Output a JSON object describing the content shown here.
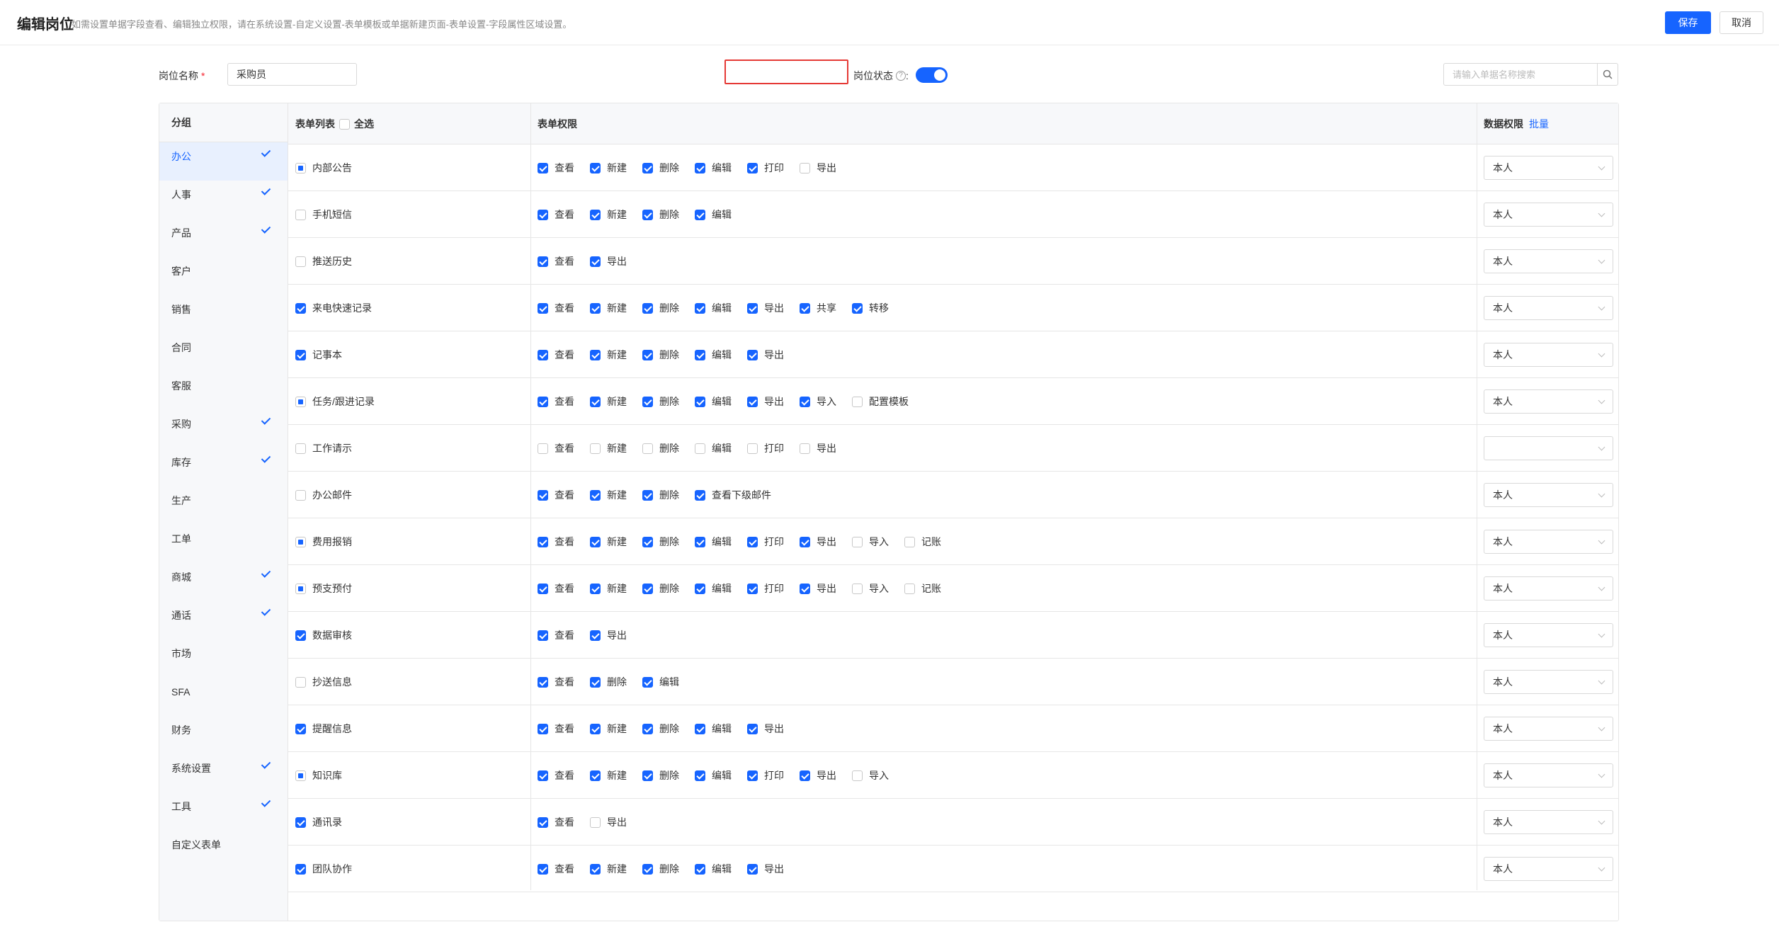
{
  "header": {
    "title": "编辑岗位",
    "hint": "如需设置单据字段查看、编辑独立权限，请在系统设置-自定义设置-表单模板或单据新建页面-表单设置-字段属性区域设置。",
    "save_label": "保存",
    "cancel_label": "取消"
  },
  "form": {
    "name_label": "岗位名称",
    "required_mark": "*",
    "name_value": "采购员",
    "status_label": "岗位状态",
    "help_glyph": "?",
    "status_colon": ":",
    "status_on": true,
    "search_placeholder": "请输入单据名称搜索"
  },
  "sidebar": {
    "header": "分组",
    "items": [
      {
        "label": "办公",
        "checked": true,
        "active": true
      },
      {
        "label": "人事",
        "checked": true
      },
      {
        "label": "产品",
        "checked": true
      },
      {
        "label": "客户",
        "checked": false
      },
      {
        "label": "销售",
        "checked": false
      },
      {
        "label": "合同",
        "checked": false
      },
      {
        "label": "客服",
        "checked": false
      },
      {
        "label": "采购",
        "checked": true
      },
      {
        "label": "库存",
        "checked": true
      },
      {
        "label": "生产",
        "checked": false
      },
      {
        "label": "工单",
        "checked": false
      },
      {
        "label": "商城",
        "checked": true
      },
      {
        "label": "通话",
        "checked": true
      },
      {
        "label": "市场",
        "checked": false
      },
      {
        "label": "SFA",
        "checked": false
      },
      {
        "label": "财务",
        "checked": false
      },
      {
        "label": "系统设置",
        "checked": true
      },
      {
        "label": "工具",
        "checked": true
      },
      {
        "label": "自定义表单",
        "checked": false
      }
    ]
  },
  "table": {
    "col_forms": "表单列表",
    "select_all": "全选",
    "col_perms": "表单权限",
    "col_data": "数据权限",
    "batch_link": "批量",
    "rows": [
      {
        "name": "内部公告",
        "state": "partial",
        "perms": [
          [
            "查看",
            1
          ],
          [
            "新建",
            1
          ],
          [
            "删除",
            1
          ],
          [
            "编辑",
            1
          ],
          [
            "打印",
            1
          ],
          [
            "导出",
            0
          ]
        ],
        "data": "本人"
      },
      {
        "name": "手机短信",
        "state": "off",
        "perms": [
          [
            "查看",
            1
          ],
          [
            "新建",
            1
          ],
          [
            "删除",
            1
          ],
          [
            "编辑",
            1
          ]
        ],
        "data": "本人"
      },
      {
        "name": "推送历史",
        "state": "off",
        "perms": [
          [
            "查看",
            1
          ],
          [
            "导出",
            1
          ]
        ],
        "data": "本人"
      },
      {
        "name": "来电快速记录",
        "state": "on",
        "perms": [
          [
            "查看",
            1
          ],
          [
            "新建",
            1
          ],
          [
            "删除",
            1
          ],
          [
            "编辑",
            1
          ],
          [
            "导出",
            1
          ],
          [
            "共享",
            1
          ],
          [
            "转移",
            1
          ]
        ],
        "data": "本人"
      },
      {
        "name": "记事本",
        "state": "on",
        "perms": [
          [
            "查看",
            1
          ],
          [
            "新建",
            1
          ],
          [
            "删除",
            1
          ],
          [
            "编辑",
            1
          ],
          [
            "导出",
            1
          ]
        ],
        "data": "本人"
      },
      {
        "name": "任务/跟进记录",
        "state": "partial",
        "perms": [
          [
            "查看",
            1
          ],
          [
            "新建",
            1
          ],
          [
            "删除",
            1
          ],
          [
            "编辑",
            1
          ],
          [
            "导出",
            1
          ],
          [
            "导入",
            1
          ],
          [
            "配置模板",
            0
          ]
        ],
        "data": "本人"
      },
      {
        "name": "工作请示",
        "state": "off",
        "perms": [
          [
            "查看",
            0
          ],
          [
            "新建",
            0
          ],
          [
            "删除",
            0
          ],
          [
            "编辑",
            0
          ],
          [
            "打印",
            0
          ],
          [
            "导出",
            0
          ]
        ],
        "data": ""
      },
      {
        "name": "办公邮件",
        "state": "off",
        "perms": [
          [
            "查看",
            1
          ],
          [
            "新建",
            1
          ],
          [
            "删除",
            1
          ],
          [
            "查看下级邮件",
            1
          ]
        ],
        "data": "本人"
      },
      {
        "name": "费用报销",
        "state": "partial",
        "perms": [
          [
            "查看",
            1
          ],
          [
            "新建",
            1
          ],
          [
            "删除",
            1
          ],
          [
            "编辑",
            1
          ],
          [
            "打印",
            1
          ],
          [
            "导出",
            1
          ],
          [
            "导入",
            0
          ],
          [
            "记账",
            0
          ]
        ],
        "data": "本人"
      },
      {
        "name": "预支预付",
        "state": "partial",
        "perms": [
          [
            "查看",
            1
          ],
          [
            "新建",
            1
          ],
          [
            "删除",
            1
          ],
          [
            "编辑",
            1
          ],
          [
            "打印",
            1
          ],
          [
            "导出",
            1
          ],
          [
            "导入",
            0
          ],
          [
            "记账",
            0
          ]
        ],
        "data": "本人"
      },
      {
        "name": "数据审核",
        "state": "on",
        "perms": [
          [
            "查看",
            1
          ],
          [
            "导出",
            1
          ]
        ],
        "data": "本人"
      },
      {
        "name": "抄送信息",
        "state": "off",
        "perms": [
          [
            "查看",
            1
          ],
          [
            "删除",
            1
          ],
          [
            "编辑",
            1
          ]
        ],
        "data": "本人"
      },
      {
        "name": "提醒信息",
        "state": "on",
        "perms": [
          [
            "查看",
            1
          ],
          [
            "新建",
            1
          ],
          [
            "删除",
            1
          ],
          [
            "编辑",
            1
          ],
          [
            "导出",
            1
          ]
        ],
        "data": "本人"
      },
      {
        "name": "知识库",
        "state": "partial",
        "perms": [
          [
            "查看",
            1
          ],
          [
            "新建",
            1
          ],
          [
            "删除",
            1
          ],
          [
            "编辑",
            1
          ],
          [
            "打印",
            1
          ],
          [
            "导出",
            1
          ],
          [
            "导入",
            0
          ]
        ],
        "data": "本人"
      },
      {
        "name": "通讯录",
        "state": "on",
        "perms": [
          [
            "查看",
            1
          ],
          [
            "导出",
            0
          ]
        ],
        "data": "本人"
      },
      {
        "name": "团队协作",
        "state": "on",
        "perms": [
          [
            "查看",
            1
          ],
          [
            "新建",
            1
          ],
          [
            "删除",
            1
          ],
          [
            "编辑",
            1
          ],
          [
            "导出",
            1
          ]
        ],
        "data": "本人"
      }
    ]
  },
  "colors": {
    "primary": "#1664ff",
    "highlight_border": "#e53935",
    "required": "#f5222d"
  }
}
